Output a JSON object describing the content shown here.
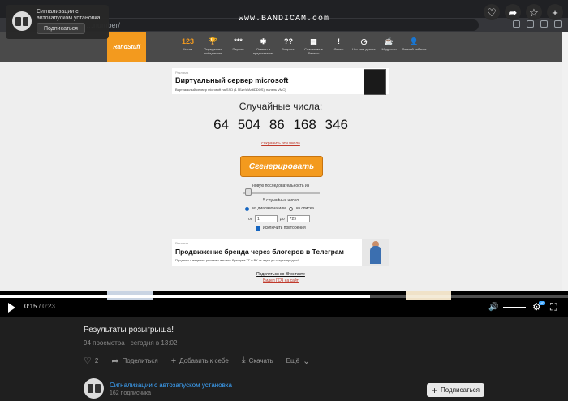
{
  "notification": {
    "text": "Сигнализации с автозапуском установка",
    "button": "Подписаться"
  },
  "browser": {
    "url_partial": "…number/",
    "watermark": "www.BANDICAM.com"
  },
  "site": {
    "logo": "RandStuff",
    "nav": [
      {
        "icon": "123",
        "label": "Числа",
        "active": true
      },
      {
        "icon": "trophy-icon",
        "label": "Определить победителя"
      },
      {
        "icon": "***",
        "label": "Пароли"
      },
      {
        "icon": "wheel-icon",
        "label": "Ответы и предсказания"
      },
      {
        "icon": "??",
        "label": "Вопросы"
      },
      {
        "icon": "ticket-icon",
        "label": "Счастливые билеты"
      },
      {
        "icon": "!",
        "label": "Факты"
      },
      {
        "icon": "clock-icon",
        "label": "Что мне делать"
      },
      {
        "icon": "cup-icon",
        "label": "Мудрости"
      },
      {
        "icon": "user-icon",
        "label": "Личный кабинет"
      }
    ],
    "ad_top": {
      "source": "Реклама",
      "title": "Виртуальный сервер microsoft",
      "desc": "Виртуальный сервер microsoft на SSD (1 ГБит/с/AntiDDOS), панель VMC)"
    },
    "heading": "Случайные числа:",
    "numbers": "64 504 86 168 346",
    "save_link": "сохранить эти числа",
    "generate_button": "Сгенерировать",
    "new_sequence": "новую последовательность из",
    "count_label": "5 случайных чисел",
    "radio_range": "из диапазона или",
    "radio_list": "из списка",
    "from_label": "от",
    "from_value": "1",
    "to_label": "до",
    "to_value": "729",
    "exclude_label": "исключить повторения",
    "ad_bottom": {
      "source": "Реклама",
      "title": "Продвижение бренда через блогеров в Телеграм",
      "desc": "Продажи и ведение рекламы вашего бренда в TГ и ВК от идеи до старта продаж!"
    },
    "vk_link": "Поделиться во ВКонтакте",
    "ad_link": "Видел ГСЧ на сайт"
  },
  "player": {
    "current_time": "0:15",
    "duration": "0:23",
    "progress": 0.652,
    "settings_badge": "HD"
  },
  "video": {
    "title": "Результаты розыгрыша!",
    "views": "94 просмотра",
    "date": "сегодня в 13:02",
    "likes": "2",
    "share": "Поделиться",
    "add": "Добавить к себе",
    "download": "Скачать",
    "more": "Ещё"
  },
  "channel": {
    "name": "Сигнализации с автозапуском установка",
    "subs": "162 подписчика",
    "subscribe": "Подписаться"
  }
}
